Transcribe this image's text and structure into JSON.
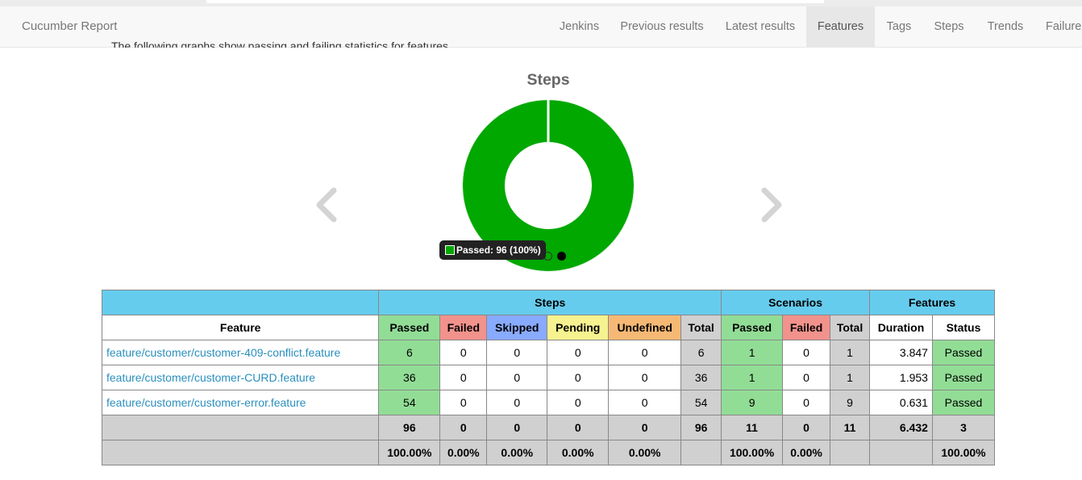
{
  "navbar": {
    "brand": "Cucumber Report",
    "items": [
      {
        "label": "Jenkins",
        "active": false
      },
      {
        "label": "Previous results",
        "active": false
      },
      {
        "label": "Latest results",
        "active": false
      },
      {
        "label": "Features",
        "active": true
      },
      {
        "label": "Tags",
        "active": false
      },
      {
        "label": "Steps",
        "active": false
      },
      {
        "label": "Trends",
        "active": false
      },
      {
        "label": "Failures",
        "active": false
      }
    ]
  },
  "intro_text": "The following graphs show passing and failing statistics for features",
  "chart": {
    "title": "Steps",
    "tooltip": "Passed: 96 (100%)",
    "carousel_pages": 2,
    "carousel_active_page": 2
  },
  "chart_data": {
    "type": "pie",
    "title": "Steps",
    "slices": [
      {
        "label": "Passed",
        "value": 96,
        "percent": 100,
        "color": "#00a800"
      }
    ]
  },
  "colors": {
    "passed": "#92dd96",
    "failed": "#f2928c",
    "skipped": "#88aaff",
    "pending": "#f5f28f",
    "undefined": "#f5b975",
    "header": "#66ccee",
    "donut": "#00a800"
  },
  "table": {
    "group_headers": {
      "steps": "Steps",
      "scenarios": "Scenarios",
      "features": "Features"
    },
    "columns": {
      "feature": "Feature",
      "steps_passed": "Passed",
      "steps_failed": "Failed",
      "steps_skipped": "Skipped",
      "steps_pending": "Pending",
      "steps_undefined": "Undefined",
      "steps_total": "Total",
      "scen_passed": "Passed",
      "scen_failed": "Failed",
      "scen_total": "Total",
      "duration": "Duration",
      "status": "Status"
    },
    "rows": [
      {
        "feature": "feature/customer/customer-409-conflict.feature",
        "passed": "6",
        "failed": "0",
        "skipped": "0",
        "pending": "0",
        "undefined": "0",
        "total": "6",
        "scen_passed": "1",
        "scen_failed": "0",
        "scen_total": "1",
        "duration": "3.847",
        "status": "Passed"
      },
      {
        "feature": "feature/customer/customer-CURD.feature",
        "passed": "36",
        "failed": "0",
        "skipped": "0",
        "pending": "0",
        "undefined": "0",
        "total": "36",
        "scen_passed": "1",
        "scen_failed": "0",
        "scen_total": "1",
        "duration": "1.953",
        "status": "Passed"
      },
      {
        "feature": "feature/customer/customer-error.feature",
        "passed": "54",
        "failed": "0",
        "skipped": "0",
        "pending": "0",
        "undefined": "0",
        "total": "54",
        "scen_passed": "9",
        "scen_failed": "0",
        "scen_total": "9",
        "duration": "0.631",
        "status": "Passed"
      }
    ],
    "totals": {
      "passed": "96",
      "failed": "0",
      "skipped": "0",
      "pending": "0",
      "undefined": "0",
      "total": "96",
      "scen_passed": "11",
      "scen_failed": "0",
      "scen_total": "11",
      "duration": "6.432",
      "status": "3"
    },
    "percentages": {
      "passed": "100.00%",
      "failed": "0.00%",
      "skipped": "0.00%",
      "pending": "0.00%",
      "undefined": "0.00%",
      "scen_passed": "100.00%",
      "scen_failed": "0.00%",
      "status": "100.00%"
    }
  }
}
